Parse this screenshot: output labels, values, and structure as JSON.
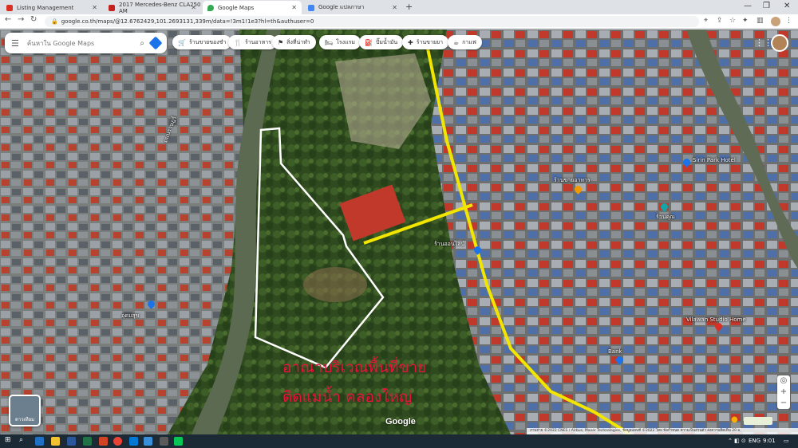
{
  "browser": {
    "tabs": [
      {
        "title": "Listing Management",
        "color": "#d93025"
      },
      {
        "title": "2017 Mercedes-Benz CLA250 AM",
        "color": "#c5221f"
      },
      {
        "title": "Google Maps",
        "color": "#34a853"
      },
      {
        "title": "Google แปลภาษา",
        "color": "#4285f4"
      }
    ],
    "url": "google.co.th/maps/@12.6762429,101.2693131,339m/data=!3m1!1e3?hl=th&authuser=0"
  },
  "map": {
    "search_placeholder": "ค้นหาใน Google Maps",
    "chips": [
      {
        "label": "ร้านขายของชำ",
        "icon": "cart-icon"
      },
      {
        "label": "ร้านอาหาร",
        "icon": "fork-knife-icon"
      },
      {
        "label": "สิ่งที่น่าทำ",
        "icon": "ticket-icon"
      },
      {
        "label": "โรงแรม",
        "icon": "bed-icon"
      },
      {
        "label": "ปั๊มน้ำมัน",
        "icon": "gas-icon"
      },
      {
        "label": "ร้านขายยา",
        "icon": "pharmacy-icon"
      },
      {
        "label": "กาแฟ",
        "icon": "coffee-icon"
      }
    ],
    "place_labels": [
      "อุดมสุข",
      "Sirin Park Hotel",
      "Vilawan Studio Home",
      "ร้านขายอาหาร",
      "ร้านออนไลน์",
      "Bank",
      "ถนนราษฎร์",
      "ร้านคุณ"
    ],
    "overlay_lines": [
      "อาณาบริเวณพื้นที่ขาย",
      "ติดแม่น้ำ คลองใหญ่"
    ],
    "layers_label": "ดาวเทียม",
    "google_logo": "Google",
    "attribution": "ภาพถ่าย ©2022 CNES / Airbus, Maxar Technologies, ข้อมูลแผนที่ ©2022  ไทย  ข้อกำหนด  ความเป็นส่วนตัว  ส่งความคิดเห็น  20 ม."
  },
  "taskbar": {
    "time": "9:01",
    "lang": "ENG"
  }
}
